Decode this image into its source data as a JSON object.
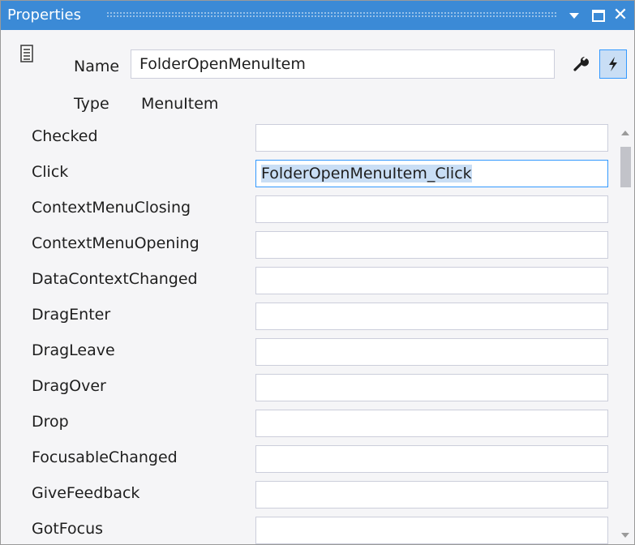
{
  "window": {
    "title": "Properties",
    "accent_color": "#3b8ad6",
    "controls": {
      "menu_icon": "dropdown-triangle-icon",
      "maximize_icon": "maximize-icon",
      "close_icon": "close-icon"
    }
  },
  "header": {
    "icon": "property-page-icon",
    "name_label": "Name",
    "name_value": "FolderOpenMenuItem",
    "type_label": "Type",
    "type_value": "MenuItem",
    "properties_button_icon": "wrench-icon",
    "events_button_icon": "lightning-bolt-icon"
  },
  "events": [
    {
      "name": "Checked",
      "handler": ""
    },
    {
      "name": "Click",
      "handler": "FolderOpenMenuItem_Click"
    },
    {
      "name": "ContextMenuClosing",
      "handler": ""
    },
    {
      "name": "ContextMenuOpening",
      "handler": ""
    },
    {
      "name": "DataContextChanged",
      "handler": ""
    },
    {
      "name": "DragEnter",
      "handler": ""
    },
    {
      "name": "DragLeave",
      "handler": ""
    },
    {
      "name": "DragOver",
      "handler": ""
    },
    {
      "name": "Drop",
      "handler": ""
    },
    {
      "name": "FocusableChanged",
      "handler": ""
    },
    {
      "name": "GiveFeedback",
      "handler": ""
    },
    {
      "name": "GotFocus",
      "handler": ""
    }
  ]
}
